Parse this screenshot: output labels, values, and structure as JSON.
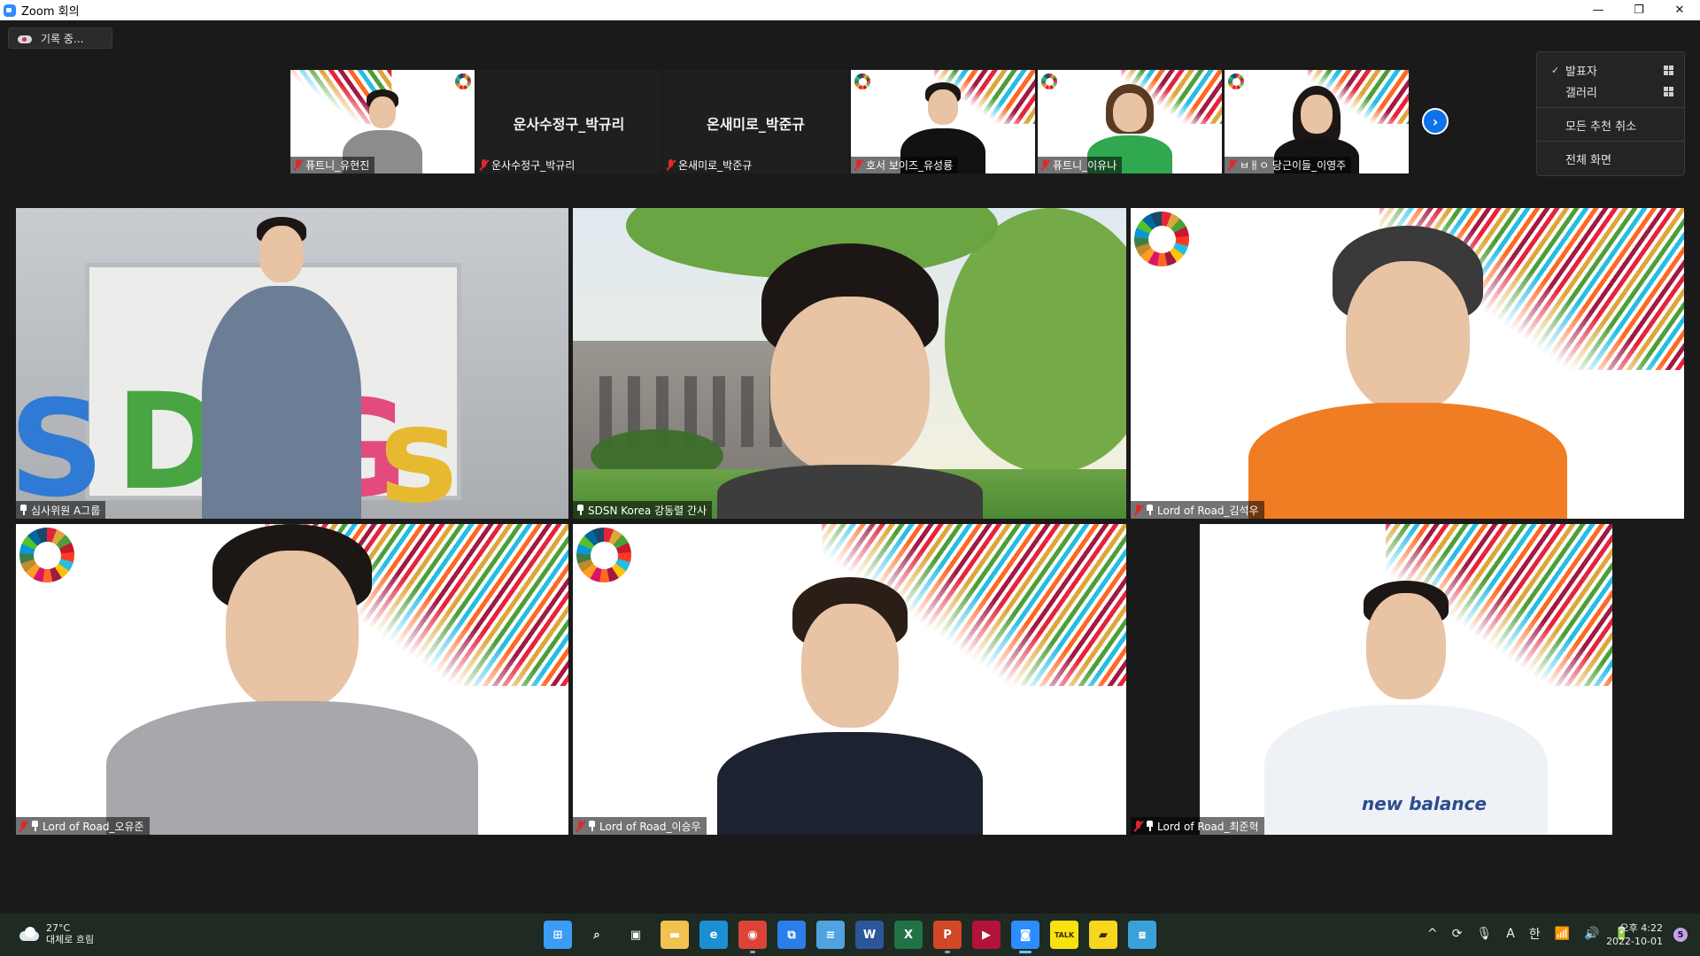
{
  "window": {
    "title": "Zoom 회의",
    "controls": [
      "—",
      "❐",
      "✕"
    ]
  },
  "recording": {
    "label": "기록 중..."
  },
  "view_menu": {
    "items": [
      {
        "label": "발표자",
        "checked": true,
        "icon": "grid-icon"
      },
      {
        "label": "갤러리",
        "checked": false,
        "icon": "grid-icon"
      },
      {
        "label": "모든 추천 취소"
      },
      {
        "label": "전체 화면"
      }
    ],
    "check_mark": "✓"
  },
  "strip": {
    "participants": [
      {
        "name": "퓨트니_유현진",
        "muted": true,
        "video": true
      },
      {
        "name": "운사수정구_박규리",
        "display": "운사수정구_박규리",
        "muted": true,
        "video": false
      },
      {
        "name": "온새미로_박준규",
        "display": "온새미로_박준규",
        "muted": true,
        "video": false
      },
      {
        "name": "호서 보이즈_유성룡",
        "muted": true,
        "video": true
      },
      {
        "name": "퓨트니_이유나",
        "muted": true,
        "video": true
      },
      {
        "name": "ㅂㅐㅇ 당근이들_이영주",
        "muted": true,
        "video": true
      }
    ],
    "next_arrow": "›"
  },
  "gallery": {
    "tiles": [
      {
        "name": "심사위원 A그룹",
        "muted": false,
        "pinned": true
      },
      {
        "name": "SDSN Korea 강동렬 간사",
        "muted": false,
        "pinned": true,
        "active": true
      },
      {
        "name": "Lord of Road_김석우",
        "muted": true,
        "pinned": true
      },
      {
        "name": "Lord of Road_오유준",
        "muted": true,
        "pinned": true
      },
      {
        "name": "Lord of Road_이승우",
        "muted": true,
        "pinned": true
      },
      {
        "name": "Lord of Road_최준혁",
        "muted": true,
        "pinned": true
      }
    ],
    "room_letters": [
      "S",
      "D",
      "G",
      "s"
    ],
    "shirt_text": "new balance"
  },
  "taskbar": {
    "weather": {
      "temp": "27°C",
      "desc": "대체로 흐림"
    },
    "apps": [
      {
        "name": "start",
        "glyph": "⊞",
        "color": "#3b9cf5",
        "running": false
      },
      {
        "name": "search",
        "glyph": "⌕",
        "color": "#1e2a22",
        "running": false
      },
      {
        "name": "task-view",
        "glyph": "▣",
        "color": "#1e2a22",
        "running": false
      },
      {
        "name": "file-explorer",
        "glyph": "▬",
        "color": "#f2c14e",
        "running": false
      },
      {
        "name": "edge",
        "glyph": "e",
        "color": "#1b8fd3",
        "running": false
      },
      {
        "name": "chrome",
        "glyph": "◉",
        "color": "#db4437",
        "running": true
      },
      {
        "name": "teams-like",
        "glyph": "⧉",
        "color": "#2b7de9",
        "running": false
      },
      {
        "name": "notepad",
        "glyph": "≡",
        "color": "#4fa3e0",
        "running": false
      },
      {
        "name": "word",
        "glyph": "W",
        "color": "#2b579a",
        "running": false
      },
      {
        "name": "excel",
        "glyph": "X",
        "color": "#217346",
        "running": false
      },
      {
        "name": "powerpoint",
        "glyph": "P",
        "color": "#d24726",
        "running": true
      },
      {
        "name": "pdf-reader",
        "glyph": "▶",
        "color": "#b3123b",
        "running": false
      },
      {
        "name": "zoom",
        "glyph": "◙",
        "color": "#2d8cff",
        "running": true,
        "active": true
      },
      {
        "name": "kakaotalk",
        "glyph": "TALK",
        "color": "#f7e111",
        "running": false
      },
      {
        "name": "sticky-notes",
        "glyph": "▰",
        "color": "#f7d61f",
        "running": false
      },
      {
        "name": "snipping",
        "glyph": "⧈",
        "color": "#3aa0d8",
        "running": false
      }
    ],
    "tray": [
      "^",
      "⟳",
      "🎙",
      "A",
      "한",
      "📶",
      "🔊",
      "🔋"
    ],
    "clock": {
      "time": "오후 4:22",
      "date": "2022-10-01"
    },
    "notification_count": "5"
  }
}
